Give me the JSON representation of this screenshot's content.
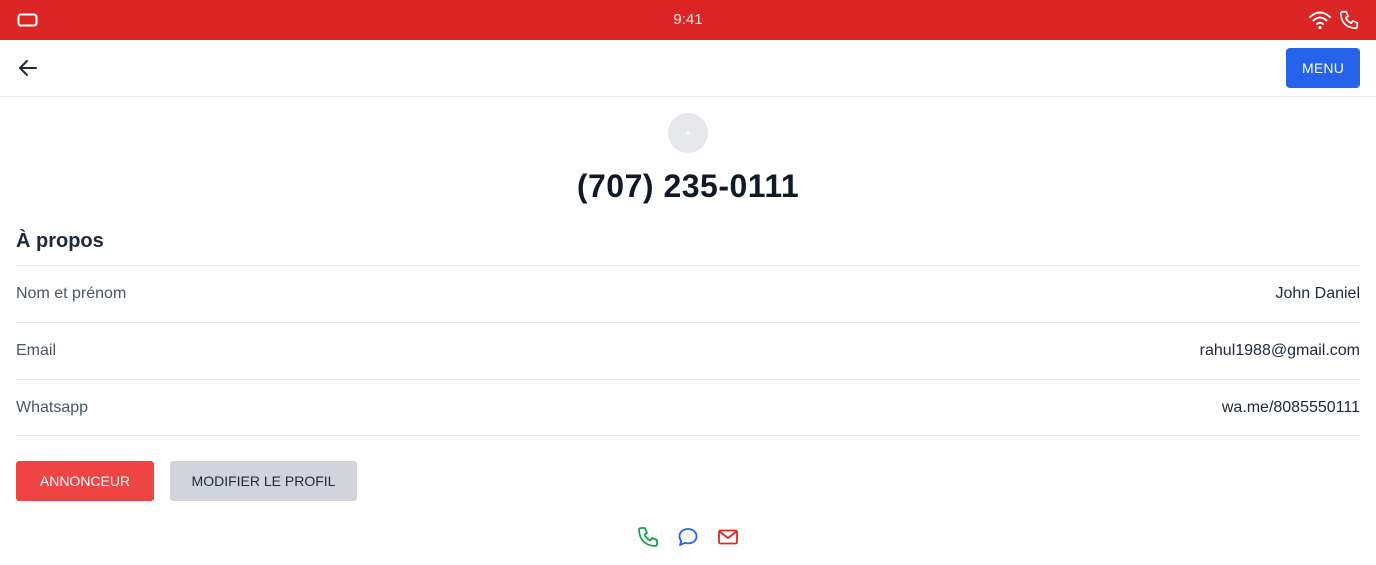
{
  "status_bar": {
    "time": "9:41",
    "left_icon": "tablet-icon",
    "right_icons": [
      "wifi-icon",
      "phone-icon"
    ],
    "color": "#dc2626"
  },
  "top_bar": {
    "back_icon": "arrow-left-icon",
    "menu_label": "MENU",
    "menu_color": "#2563eb"
  },
  "profile": {
    "phone": "(707) 235-0111"
  },
  "about": {
    "title": "À propos",
    "rows": [
      {
        "label": "Nom et prénom",
        "value": "John Daniel"
      },
      {
        "label": "Email",
        "value": "rahul1988@gmail.com"
      },
      {
        "label": "Whatsapp",
        "value": "wa.me/8085550111"
      }
    ]
  },
  "actions": {
    "announcer_label": "ANNONCEUR",
    "announcer_color": "#ef4444",
    "edit_label": "MODIFIER LE PROFIL"
  },
  "contact_icons": [
    {
      "icon": "phone-icon",
      "color": "#16a34a"
    },
    {
      "icon": "chat-bubble-icon",
      "color": "#2563eb"
    },
    {
      "icon": "mail-icon",
      "color": "#dc2626"
    }
  ]
}
